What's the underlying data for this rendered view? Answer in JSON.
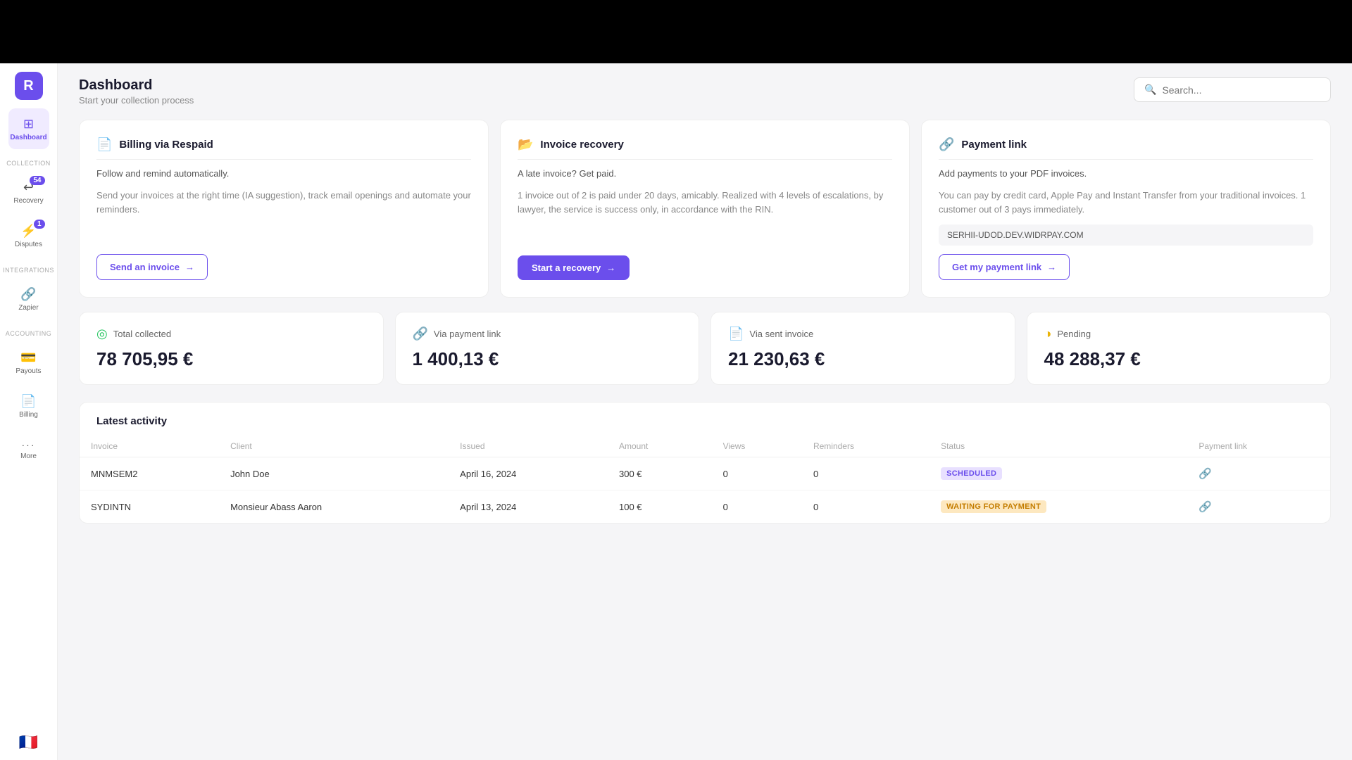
{
  "app": {
    "logo_letter": "R",
    "top_bar_height": 90
  },
  "sidebar": {
    "items": [
      {
        "id": "dashboard",
        "label": "Dashboard",
        "icon": "⊞",
        "active": true,
        "badge": null
      },
      {
        "id": "recovery",
        "label": "Recovery",
        "icon": "↩",
        "active": false,
        "badge": "54"
      },
      {
        "id": "disputes",
        "label": "Disputes",
        "icon": "⚡",
        "active": false,
        "badge": "1"
      },
      {
        "id": "zapier",
        "label": "Zapier",
        "icon": "🔗",
        "active": false,
        "badge": null
      },
      {
        "id": "payouts",
        "label": "Payouts",
        "icon": "💳",
        "active": false,
        "badge": null
      },
      {
        "id": "billing",
        "label": "Billing",
        "icon": "📄",
        "active": false,
        "badge": null
      },
      {
        "id": "more",
        "label": "More",
        "icon": "···",
        "active": false,
        "badge": null
      }
    ],
    "section_labels": {
      "collection": "COLLECTION",
      "integrations": "INTEGRATIONS",
      "accounting": "ACCOUNTING"
    },
    "flag": "🇫🇷"
  },
  "header": {
    "title": "Dashboard",
    "subtitle": "Start your collection process",
    "search_placeholder": "Search..."
  },
  "cards": [
    {
      "id": "billing",
      "icon": "📄",
      "title": "Billing via Respaid",
      "description": "Follow and remind automatically.",
      "body": "Send your invoices at the right time (IA suggestion), track email openings and automate your reminders.",
      "button_label": "Send an invoice",
      "button_type": "outline"
    },
    {
      "id": "recovery",
      "icon": "📂",
      "title": "Invoice recovery",
      "description": "A late invoice? Get paid.",
      "body": "1 invoice out of 2 is paid under 20 days, amicably. Realized with 4 levels of escalations, by lawyer, the service is success only, in accordance with the RIN.",
      "button_label": "Start a recovery",
      "button_type": "primary"
    },
    {
      "id": "payment",
      "icon": "🔗",
      "title": "Payment link",
      "description": "Add payments to your PDF invoices.",
      "body": "You can pay by credit card, Apple Pay and Instant Transfer from your traditional invoices. 1 customer out of 3 pays immediately.",
      "domain": "SERHII-UDOD.DEV.WIDRPAY.COM",
      "button_label": "Get my payment link",
      "button_type": "outline"
    }
  ],
  "stats": [
    {
      "id": "total",
      "icon": "◎",
      "icon_color": "green",
      "label": "Total collected",
      "value": "78 705,95 €"
    },
    {
      "id": "payment_link",
      "icon": "🔗",
      "icon_color": "blue",
      "label": "Via payment link",
      "value": "1 400,13 €"
    },
    {
      "id": "sent_invoice",
      "icon": "📄",
      "icon_color": "purple",
      "label": "Via sent invoice",
      "value": "21 230,63 €"
    },
    {
      "id": "pending",
      "icon": "◑",
      "icon_color": "yellow",
      "label": "Pending",
      "value": "48 288,37 €"
    }
  ],
  "activity": {
    "title": "Latest activity",
    "columns": [
      "Invoice",
      "Client",
      "Issued",
      "Amount",
      "Views",
      "Reminders",
      "Status",
      "Payment link"
    ],
    "rows": [
      {
        "invoice": "MNMSEM2",
        "client": "John Doe",
        "issued": "April 16, 2024",
        "amount": "300 €",
        "views": "0",
        "reminders": "0",
        "status": "SCHEDULED",
        "status_type": "scheduled",
        "has_link": true
      },
      {
        "invoice": "SYDINTN",
        "client": "Monsieur Abass Aaron",
        "issued": "April 13, 2024",
        "amount": "100 €",
        "views": "0",
        "reminders": "0",
        "status": "WAITING FOR PAYMENT",
        "status_type": "waiting",
        "has_link": true
      }
    ]
  }
}
